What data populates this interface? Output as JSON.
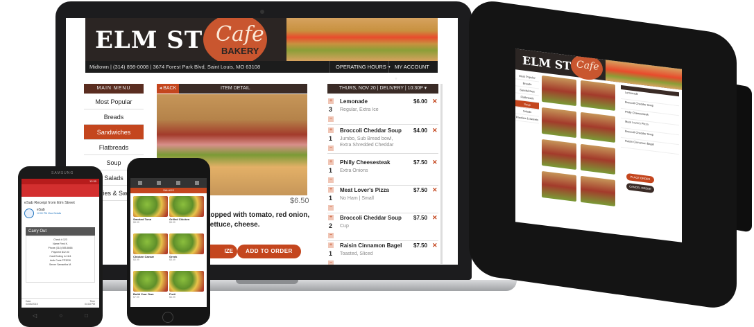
{
  "laptop": {
    "logo": {
      "elm": "ELM ST",
      "cafe": "Cafe",
      "bakery": "BAKERY"
    },
    "infobar": {
      "location": "Midtown | (314) 898-0008 | 3674 Forest Park Blvd, Saint Louis, MO 63108",
      "hours": "OPERATING HOURS ▾",
      "account": "MY ACCOUNT ▾"
    },
    "menu": {
      "header": "MAIN MENU",
      "items": [
        "Most Popular",
        "Breads",
        "Sandwiches",
        "Flatbreads",
        "Soup",
        "Salads",
        "Pastries & Sweets"
      ],
      "active_index": 2
    },
    "detail": {
      "back": "◂ BACK",
      "title": "ITEM DETAIL",
      "price": "$6.50",
      "description": "topped with tomato, red onion, lettuce, cheese.",
      "customize": "IZE",
      "add_to_order": "ADD TO ORDER"
    },
    "order": {
      "header": "THURS, NOV 20 | DELIVERY | 10:30P ▾",
      "items": [
        {
          "qty": "3",
          "name": "Lemonade",
          "sub": "Regular, Extra Ice",
          "price": "$6.00"
        },
        {
          "qty": "1",
          "name": "Broccoli Cheddar Soup",
          "sub": "Jumbo, Sub Bread bowl, Extra Shredded Cheddar",
          "price": "$4.00"
        },
        {
          "qty": "1",
          "name": "Philly Cheesesteak",
          "sub": "Extra Onions",
          "price": "$7.50"
        },
        {
          "qty": "1",
          "name": "Meat Lover's Pizza",
          "sub": "No Ham | Small",
          "price": "$7.50"
        },
        {
          "qty": "2",
          "name": "Broccoli Cheddar Soup",
          "sub": "Cup",
          "price": "$7.50"
        },
        {
          "qty": "1",
          "name": "Raisin Cinnamon Bagel",
          "sub": "Toasted, Sliced",
          "price": "$7.50"
        }
      ]
    }
  },
  "tablet": {
    "elm": "ELM ST",
    "cafe": "Cafe",
    "side": [
      "Most Popular",
      "Breads",
      "Sandwiches",
      "Flatbreads",
      "Soup",
      "Salads",
      "Pastries & Sweets"
    ],
    "order": [
      "Lemonade",
      "Broccoli Cheddar Soup",
      "Philly Cheesesteak",
      "Meat Lover's Pizza",
      "Broccoli Cheddar Soup",
      "Raisin Cinnamon Bagel"
    ],
    "place_order": "PLACE ORDER",
    "cancel_order": "CANCEL ORDER"
  },
  "android": {
    "brand": "SAMSUNG",
    "status_time": "12:30",
    "subject": "eSab Receipt from Elm Street",
    "sender": "eSab",
    "sender_detail": "12:00 PM View Details",
    "carry_out": "Carry Out",
    "receipt": [
      "Check #  123",
      "Name  Fred K.",
      "Phone  (314) 555-6666",
      "Payment  $12.00",
      "Card Ending in  1111",
      "Auth Code  PP3230",
      "Server  Samantha M."
    ],
    "footer_date_label": "Date",
    "footer_time_label": "Time",
    "footer_date": "03/06/2015",
    "footer_time": "04:18 PM"
  },
  "iphone": {
    "tab": "SALADS",
    "items": [
      {
        "name": "Smoked Tuna",
        "price": "$8.99"
      },
      {
        "name": "Grilled Chicken",
        "price": "$8.99"
      },
      {
        "name": "Chicken Caesar",
        "price": "$8.99"
      },
      {
        "name": "Greek",
        "price": "$8.49"
      },
      {
        "name": "Build Your Own",
        "price": "$7.99"
      },
      {
        "name": "Fruit",
        "price": "$6.99"
      }
    ]
  }
}
